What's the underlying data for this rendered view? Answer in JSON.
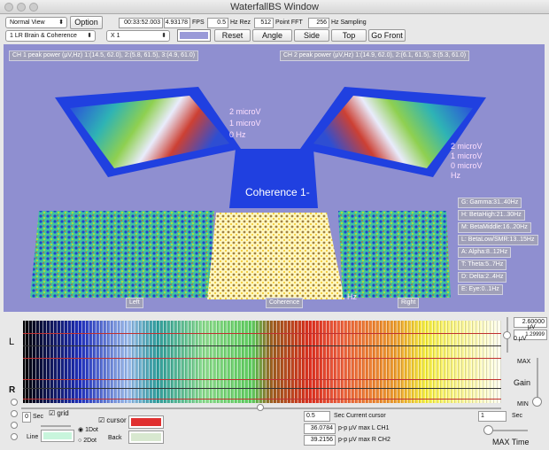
{
  "window": {
    "title": "WaterfallBS Window"
  },
  "toolbar": {
    "view_mode": "Normal View",
    "option": "Option",
    "time": "00:33:52.003",
    "fps_value": "4.93178",
    "fps_label": "FPS",
    "hz_rez_value": "0.5",
    "hz_rez_label": "Hz Rez",
    "fft_value": "512",
    "fft_label": "Point FFT",
    "sampling_value": "256",
    "sampling_label": "Hz Sampling",
    "display_mode": "1 LR Brain & Coherence",
    "scale": "X 1",
    "color_swatch": "#9a9ad8",
    "reset": "Reset",
    "angle": "Angle",
    "side": "Side",
    "top": "Top",
    "go_front": "Go Front"
  },
  "view3d": {
    "ch1_peak": "CH 1 peak power (μV,Hz) 1:(14.5, 62.0), 2:(5.8, 61.5), 3:(4.9, 61.0)",
    "ch2_peak": "CH 2 peak power (μV,Hz) 1:(14.9, 62.0), 2:(6.1, 61.5), 3:(5.3, 61.0)",
    "left_axis": [
      "2 microV",
      "1 microV",
      "0 Hz"
    ],
    "right_axis": [
      "2 microV",
      "1 microV",
      "0 microV",
      "Hz"
    ],
    "coherence_title": "Coherence 1-",
    "hz": "Hz",
    "panel_left": "Left",
    "panel_coherence": "Coherence",
    "panel_right": "Right",
    "bands": [
      "G: Gamma:31..40Hz",
      "H: BetaHigh:21..30Hz",
      "M: BetaMiddle:16..20Hz",
      "L: BetaLow/SMR:13..15Hz",
      "A: Alpha:8..12Hz",
      "T: Theta:5..7Hz",
      "D: Delta:2..4Hz",
      "E: Eye:0..1Hz"
    ],
    "background": "#8f8fd0"
  },
  "waterfall": {
    "label_l": "L",
    "label_r": "R",
    "max_uv": "2.60000",
    "uv": "μV",
    "cursor_uv": "1.29999",
    "zero_uv": "0 μV",
    "gain_max": "MAX",
    "gain_label": "Gain",
    "gain_min": "MIN"
  },
  "controls": {
    "sec_value": "0",
    "sec_label": "Sec",
    "grid_label": "grid",
    "grid_checked": true,
    "line_label": "Line",
    "line_color": "#c8f5dc",
    "dot1": "1Dot",
    "dot2": "2Dot",
    "dot_selected": "1Dot",
    "cursor_label": "cursor",
    "cursor_checked": true,
    "cursor_color": "#e03030",
    "back_label": "Back",
    "back_color": "#d8e8d0",
    "cursor_sec": "0.5",
    "cursor_sec_label": "Sec Current cursor",
    "ch1_value": "36.0784",
    "ch1_label": "p-p μV max L CH1",
    "ch2_value": "39.2156",
    "ch2_label": "p-p μV max R CH2",
    "max_time_value": "1",
    "max_time_sec": "Sec",
    "max_time_label": "MAX Time"
  }
}
